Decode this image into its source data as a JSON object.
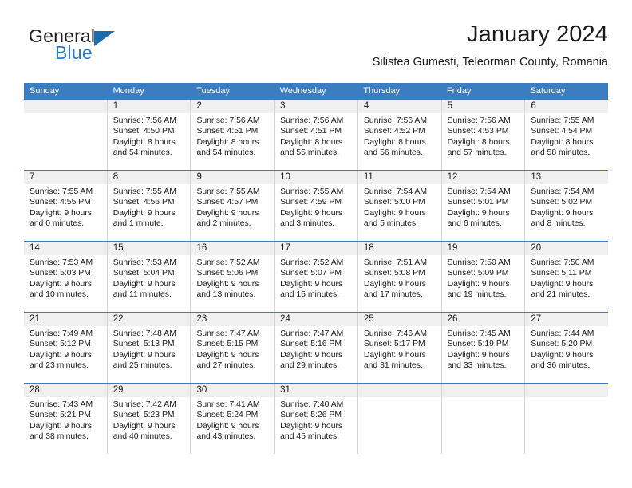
{
  "logo": {
    "word_top": "General",
    "word_bottom": "Blue",
    "mark": "blue-triangle",
    "color_dark": "#231f20",
    "color_blue": "#2b7cc4"
  },
  "header": {
    "title": "January 2024",
    "subtitle": "Silistea Gumesti, Teleorman County, Romania"
  },
  "theme": {
    "header_bar": "#3b7dc0",
    "day_number_band": "#f0f0f0",
    "cell_border": "#d4d4d4",
    "text": "#1a1a1a"
  },
  "weekdays": [
    "Sunday",
    "Monday",
    "Tuesday",
    "Wednesday",
    "Thursday",
    "Friday",
    "Saturday"
  ],
  "weeks": [
    [
      {
        "day": "",
        "sunrise": "",
        "sunset": "",
        "daylight1": "",
        "daylight2": ""
      },
      {
        "day": "1",
        "sunrise": "Sunrise: 7:56 AM",
        "sunset": "Sunset: 4:50 PM",
        "daylight1": "Daylight: 8 hours",
        "daylight2": "and 54 minutes."
      },
      {
        "day": "2",
        "sunrise": "Sunrise: 7:56 AM",
        "sunset": "Sunset: 4:51 PM",
        "daylight1": "Daylight: 8 hours",
        "daylight2": "and 54 minutes."
      },
      {
        "day": "3",
        "sunrise": "Sunrise: 7:56 AM",
        "sunset": "Sunset: 4:51 PM",
        "daylight1": "Daylight: 8 hours",
        "daylight2": "and 55 minutes."
      },
      {
        "day": "4",
        "sunrise": "Sunrise: 7:56 AM",
        "sunset": "Sunset: 4:52 PM",
        "daylight1": "Daylight: 8 hours",
        "daylight2": "and 56 minutes."
      },
      {
        "day": "5",
        "sunrise": "Sunrise: 7:56 AM",
        "sunset": "Sunset: 4:53 PM",
        "daylight1": "Daylight: 8 hours",
        "daylight2": "and 57 minutes."
      },
      {
        "day": "6",
        "sunrise": "Sunrise: 7:55 AM",
        "sunset": "Sunset: 4:54 PM",
        "daylight1": "Daylight: 8 hours",
        "daylight2": "and 58 minutes."
      }
    ],
    [
      {
        "day": "7",
        "sunrise": "Sunrise: 7:55 AM",
        "sunset": "Sunset: 4:55 PM",
        "daylight1": "Daylight: 9 hours",
        "daylight2": "and 0 minutes."
      },
      {
        "day": "8",
        "sunrise": "Sunrise: 7:55 AM",
        "sunset": "Sunset: 4:56 PM",
        "daylight1": "Daylight: 9 hours",
        "daylight2": "and 1 minute."
      },
      {
        "day": "9",
        "sunrise": "Sunrise: 7:55 AM",
        "sunset": "Sunset: 4:57 PM",
        "daylight1": "Daylight: 9 hours",
        "daylight2": "and 2 minutes."
      },
      {
        "day": "10",
        "sunrise": "Sunrise: 7:55 AM",
        "sunset": "Sunset: 4:59 PM",
        "daylight1": "Daylight: 9 hours",
        "daylight2": "and 3 minutes."
      },
      {
        "day": "11",
        "sunrise": "Sunrise: 7:54 AM",
        "sunset": "Sunset: 5:00 PM",
        "daylight1": "Daylight: 9 hours",
        "daylight2": "and 5 minutes."
      },
      {
        "day": "12",
        "sunrise": "Sunrise: 7:54 AM",
        "sunset": "Sunset: 5:01 PM",
        "daylight1": "Daylight: 9 hours",
        "daylight2": "and 6 minutes."
      },
      {
        "day": "13",
        "sunrise": "Sunrise: 7:54 AM",
        "sunset": "Sunset: 5:02 PM",
        "daylight1": "Daylight: 9 hours",
        "daylight2": "and 8 minutes."
      }
    ],
    [
      {
        "day": "14",
        "sunrise": "Sunrise: 7:53 AM",
        "sunset": "Sunset: 5:03 PM",
        "daylight1": "Daylight: 9 hours",
        "daylight2": "and 10 minutes."
      },
      {
        "day": "15",
        "sunrise": "Sunrise: 7:53 AM",
        "sunset": "Sunset: 5:04 PM",
        "daylight1": "Daylight: 9 hours",
        "daylight2": "and 11 minutes."
      },
      {
        "day": "16",
        "sunrise": "Sunrise: 7:52 AM",
        "sunset": "Sunset: 5:06 PM",
        "daylight1": "Daylight: 9 hours",
        "daylight2": "and 13 minutes."
      },
      {
        "day": "17",
        "sunrise": "Sunrise: 7:52 AM",
        "sunset": "Sunset: 5:07 PM",
        "daylight1": "Daylight: 9 hours",
        "daylight2": "and 15 minutes."
      },
      {
        "day": "18",
        "sunrise": "Sunrise: 7:51 AM",
        "sunset": "Sunset: 5:08 PM",
        "daylight1": "Daylight: 9 hours",
        "daylight2": "and 17 minutes."
      },
      {
        "day": "19",
        "sunrise": "Sunrise: 7:50 AM",
        "sunset": "Sunset: 5:09 PM",
        "daylight1": "Daylight: 9 hours",
        "daylight2": "and 19 minutes."
      },
      {
        "day": "20",
        "sunrise": "Sunrise: 7:50 AM",
        "sunset": "Sunset: 5:11 PM",
        "daylight1": "Daylight: 9 hours",
        "daylight2": "and 21 minutes."
      }
    ],
    [
      {
        "day": "21",
        "sunrise": "Sunrise: 7:49 AM",
        "sunset": "Sunset: 5:12 PM",
        "daylight1": "Daylight: 9 hours",
        "daylight2": "and 23 minutes."
      },
      {
        "day": "22",
        "sunrise": "Sunrise: 7:48 AM",
        "sunset": "Sunset: 5:13 PM",
        "daylight1": "Daylight: 9 hours",
        "daylight2": "and 25 minutes."
      },
      {
        "day": "23",
        "sunrise": "Sunrise: 7:47 AM",
        "sunset": "Sunset: 5:15 PM",
        "daylight1": "Daylight: 9 hours",
        "daylight2": "and 27 minutes."
      },
      {
        "day": "24",
        "sunrise": "Sunrise: 7:47 AM",
        "sunset": "Sunset: 5:16 PM",
        "daylight1": "Daylight: 9 hours",
        "daylight2": "and 29 minutes."
      },
      {
        "day": "25",
        "sunrise": "Sunrise: 7:46 AM",
        "sunset": "Sunset: 5:17 PM",
        "daylight1": "Daylight: 9 hours",
        "daylight2": "and 31 minutes."
      },
      {
        "day": "26",
        "sunrise": "Sunrise: 7:45 AM",
        "sunset": "Sunset: 5:19 PM",
        "daylight1": "Daylight: 9 hours",
        "daylight2": "and 33 minutes."
      },
      {
        "day": "27",
        "sunrise": "Sunrise: 7:44 AM",
        "sunset": "Sunset: 5:20 PM",
        "daylight1": "Daylight: 9 hours",
        "daylight2": "and 36 minutes."
      }
    ],
    [
      {
        "day": "28",
        "sunrise": "Sunrise: 7:43 AM",
        "sunset": "Sunset: 5:21 PM",
        "daylight1": "Daylight: 9 hours",
        "daylight2": "and 38 minutes."
      },
      {
        "day": "29",
        "sunrise": "Sunrise: 7:42 AM",
        "sunset": "Sunset: 5:23 PM",
        "daylight1": "Daylight: 9 hours",
        "daylight2": "and 40 minutes."
      },
      {
        "day": "30",
        "sunrise": "Sunrise: 7:41 AM",
        "sunset": "Sunset: 5:24 PM",
        "daylight1": "Daylight: 9 hours",
        "daylight2": "and 43 minutes."
      },
      {
        "day": "31",
        "sunrise": "Sunrise: 7:40 AM",
        "sunset": "Sunset: 5:26 PM",
        "daylight1": "Daylight: 9 hours",
        "daylight2": "and 45 minutes."
      },
      {
        "day": "",
        "sunrise": "",
        "sunset": "",
        "daylight1": "",
        "daylight2": ""
      },
      {
        "day": "",
        "sunrise": "",
        "sunset": "",
        "daylight1": "",
        "daylight2": ""
      },
      {
        "day": "",
        "sunrise": "",
        "sunset": "",
        "daylight1": "",
        "daylight2": ""
      }
    ]
  ]
}
